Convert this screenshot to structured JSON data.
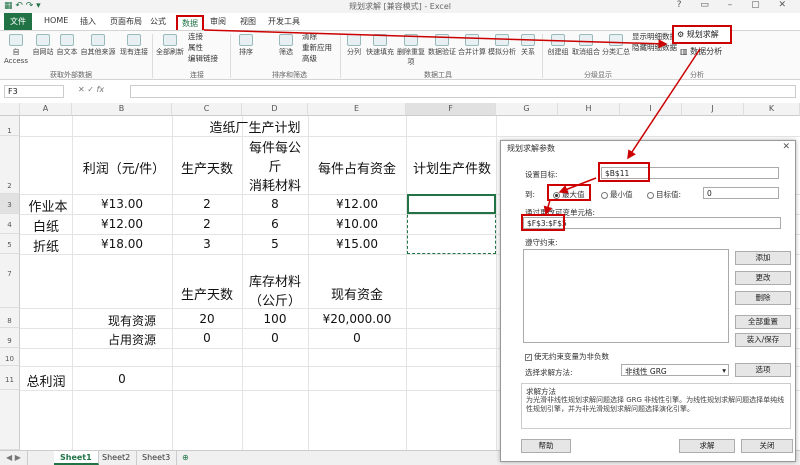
{
  "window": {
    "title": "规划求解 [兼容模式] - Excel"
  },
  "ribbon_tabs": [
    "HOME",
    "插入",
    "页面布局",
    "公式",
    "数据",
    "审阅",
    "视图",
    "开发工具"
  ],
  "file_tab": "文件",
  "ribbon_buttons": {
    "from_access": "自 Access",
    "from_web": "自网站",
    "from_text": "自文本",
    "from_other": "自其他来源",
    "existing": "现有连接",
    "refresh": "全部刷新",
    "connections": "连接",
    "properties": "属性",
    "edit_links": "编辑链接",
    "sort": "排序",
    "filter": "筛选",
    "clear": "清除",
    "reapply": "重新应用",
    "advanced": "高级",
    "split": "分列",
    "flash_fill": "快速填充",
    "remove_dup": "删除重复项",
    "validation": "数据验证",
    "consolidate": "合并计算",
    "whatif": "模拟分析",
    "relations": "关系",
    "group": "创建组",
    "ungroup": "取消组合",
    "subtotal": "分类汇总",
    "show_detail": "显示明细数据",
    "hide_detail": "隐藏明细数据",
    "solver": "规划求解",
    "data_analysis": "数据分析"
  },
  "ribbon_groups": [
    "获取外部数据",
    "连接",
    "排序和筛选",
    "数据工具",
    "分级显示",
    "分析"
  ],
  "formula_bar": {
    "namebox": "F3",
    "fx": "fx",
    "value": ""
  },
  "columns": [
    "A",
    "B",
    "C",
    "D",
    "E",
    "F",
    "G",
    "H",
    "I",
    "J",
    "K"
  ],
  "rows": [
    "1",
    "2",
    "3",
    "4",
    "5",
    "6",
    "7",
    "8",
    "9",
    "10",
    "11"
  ],
  "sheet": {
    "title": "造纸厂生产计划",
    "h_profit": "利润（元/件）",
    "h_days": "生产天数",
    "h_material_1": "每件每公",
    "h_material_2": "斤",
    "h_material_3": "消耗材料",
    "h_capital": "每件占有资金",
    "h_plan": "计划生产件数",
    "r3_name": "作业本",
    "r3_profit": "¥13.00",
    "r3_days": "2",
    "r3_mat": "8",
    "r3_cap": "¥12.00",
    "r4_name": "白纸",
    "r4_profit": "¥12.00",
    "r4_days": "2",
    "r4_mat": "6",
    "r4_cap": "¥10.00",
    "r5_name": "折纸",
    "r5_profit": "¥18.00",
    "r5_days": "3",
    "r5_mat": "5",
    "r5_cap": "¥15.00",
    "h7_days": "生产天数",
    "h7_stock_1": "库存材料",
    "h7_stock_2": "（公斤）",
    "h7_cash": "现有资金",
    "r8_label": "现有资源",
    "r8_days": "20",
    "r8_stock": "100",
    "r8_cash": "¥20,000.00",
    "r9_label": "占用资源",
    "r9_days": "0",
    "r9_stock": "0",
    "r9_cash": "0",
    "r11_label": "总利润",
    "r11_value": "0"
  },
  "sheet_tabs": [
    "Sheet1",
    "Sheet2",
    "Sheet3"
  ],
  "dialog": {
    "title": "规划求解参数",
    "set_objective_label": "设置目标:",
    "set_objective_value": "$B$11",
    "to_label": "到:",
    "opt_max": "最大值",
    "opt_min": "最小值",
    "opt_value": "目标值:",
    "target_value": "0",
    "changing_label": "通过更改可变单元格:",
    "changing_value": "$F$3:$F$5",
    "constraints_label": "遵守约束:",
    "btn_add": "添加",
    "btn_change": "更改",
    "btn_delete": "删除",
    "btn_reset": "全部重置",
    "btn_load": "装入/保存",
    "nonneg_label": "使无约束变量为非负数",
    "method_label": "选择求解方法:",
    "method_value": "非线性 GRG",
    "btn_options": "选项",
    "desc_title": "求解方法",
    "desc_text": "为光滑非线性规划求解问题选择 GRG 非线性引擎。为线性规划求解问题选择单纯线性规划引擎，并为非光滑规划求解问题选择演化引擎。",
    "btn_help": "帮助",
    "btn_solve": "求解",
    "btn_close": "关闭"
  },
  "colors": {
    "excel_green": "#217346",
    "highlight_red": "#cc0000"
  }
}
